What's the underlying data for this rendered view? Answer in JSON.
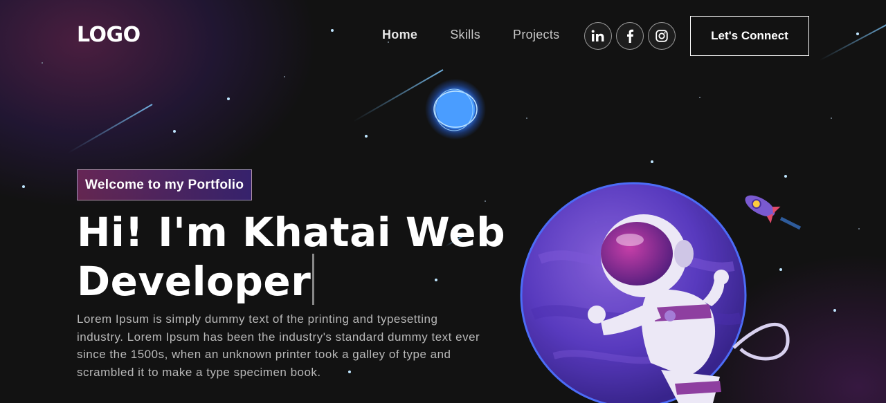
{
  "nav": {
    "logo": "LOGO",
    "links": [
      {
        "label": "Home",
        "active": true
      },
      {
        "label": "Skills",
        "active": false
      },
      {
        "label": "Projects",
        "active": false
      }
    ],
    "social": [
      {
        "name": "linkedin",
        "icon": "linkedin-icon",
        "glyph": "in"
      },
      {
        "name": "facebook",
        "icon": "facebook-icon",
        "glyph": "f"
      },
      {
        "name": "instagram",
        "icon": "instagram-icon",
        "glyph": ""
      }
    ],
    "cta_label": "Let's Connect"
  },
  "hero": {
    "tagline": "Welcome to my Portfolio",
    "headline_line1": "Hi! I'm Khatai Web",
    "headline_line2": "Developer",
    "description": "Lorem Ipsum is simply dummy text of the printing and typesetting industry. Lorem Ipsum has been the industry's standard dummy text ever since the 1500s, when an unknown printer took a galley of type and scrambled it to make a type specimen book."
  },
  "colors": {
    "background": "#121212",
    "tagline_gradient_start": "#AA367C",
    "tagline_gradient_end": "#4A2FBD",
    "planet": "#6a4fd6",
    "accent_blue": "#4fa8ff"
  }
}
